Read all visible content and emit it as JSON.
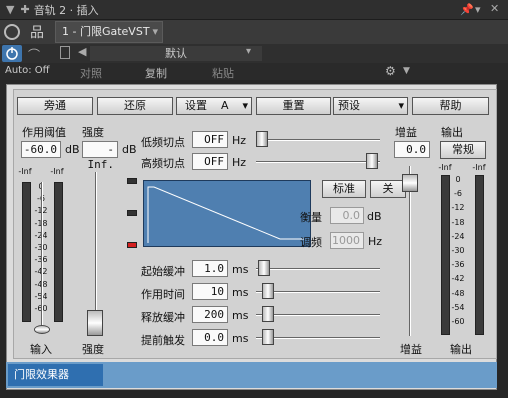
{
  "host": {
    "title": "音轨 2 · 插入",
    "plugin_tab": "1 - 门限GateVST",
    "auto_state": "Auto: Off",
    "preset_name": "默认",
    "compare_label": "对照",
    "copy_label": "复制",
    "paste_label": "粘贴"
  },
  "plugin": {
    "buttons": {
      "bypass": "旁通",
      "reset": "还原",
      "setup": "设置",
      "setup_slot": "A",
      "rearrange": "重置",
      "preset": "预设",
      "help": "帮助",
      "standard": "标准",
      "off": "关",
      "normal": "常规"
    },
    "labels": {
      "threshold": "作用阈值",
      "strength": "强度",
      "low_cut": "低频切点",
      "high_cut": "高频切点",
      "gain_top": "增益",
      "output_top": "输出",
      "balance": "衡量",
      "tune": "调频",
      "attack": "起始缓冲",
      "hold": "作用时间",
      "release": "释放缓冲",
      "lookahead": "提前触发",
      "input_bottom": "输入",
      "strength_bottom": "强度",
      "gain_bottom": "增益",
      "output_bottom": "输出"
    },
    "values": {
      "threshold": "-60.0",
      "threshold_unit": "dB",
      "strength": "-Inf.",
      "strength_unit": "dB",
      "low_cut": "OFF",
      "high_cut": "OFF",
      "hz": "Hz",
      "gain": "0.0",
      "balance": "0.0",
      "balance_unit": "dB",
      "tune": "1000",
      "tune_unit": "Hz",
      "attack": "1.0",
      "hold": "10",
      "release": "200",
      "lookahead": "0.0",
      "ms": "ms"
    },
    "meter_scale": [
      "-Inf",
      "0",
      "-6",
      "-12",
      "-18",
      "-24",
      "-30",
      "-36",
      "-42",
      "-48",
      "-54",
      "-60"
    ],
    "status_tab": "门限效果器"
  }
}
